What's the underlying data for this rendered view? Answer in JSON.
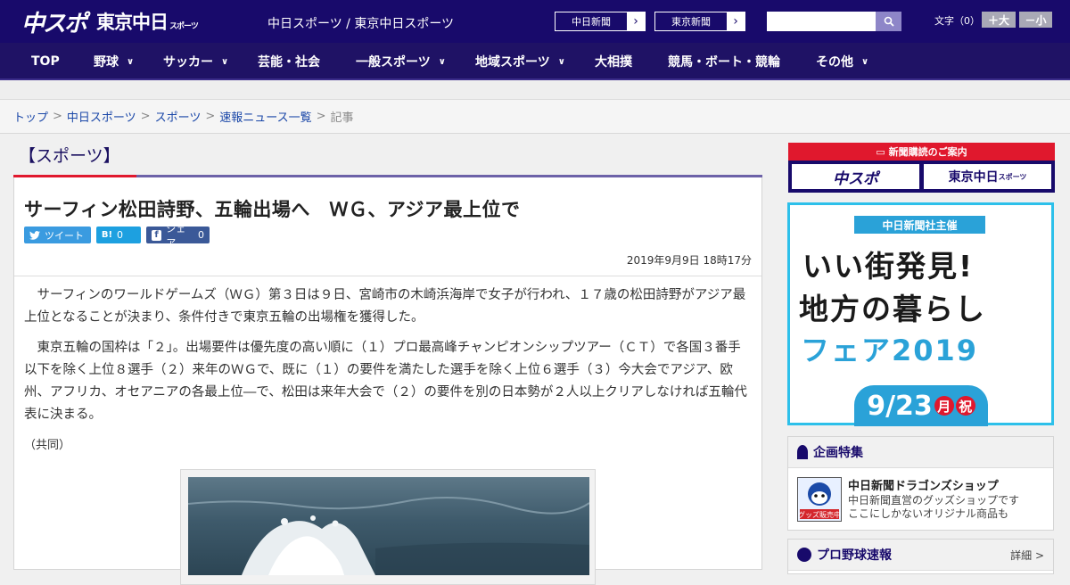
{
  "header": {
    "logo_chunichi": "中スポ",
    "logo_tokyo": "東京中日",
    "logo_tokyo_small": "スポーツ",
    "site_name": "中日スポーツ / 東京中日スポーツ",
    "paper_links": [
      {
        "label": "中日新聞"
      },
      {
        "label": "東京新聞"
      }
    ],
    "search_placeholder": "",
    "font_size_label": "文字（0）",
    "font_larger": "＋大",
    "font_smaller": "－小"
  },
  "nav": {
    "items": [
      {
        "label": "TOP",
        "has_menu": false
      },
      {
        "label": "野球",
        "has_menu": true
      },
      {
        "label": "サッカー",
        "has_menu": true
      },
      {
        "label": "芸能・社会",
        "has_menu": false
      },
      {
        "label": "一般スポーツ",
        "has_menu": true
      },
      {
        "label": "地域スポーツ",
        "has_menu": true
      },
      {
        "label": "大相撲",
        "has_menu": false
      },
      {
        "label": "競馬・ボート・競輪",
        "has_menu": false
      },
      {
        "label": "その他",
        "has_menu": true
      }
    ]
  },
  "breadcrumb": {
    "items": [
      "トップ",
      "中日スポーツ",
      "スポーツ",
      "速報ニュース一覧"
    ],
    "current": "記事",
    "separator": ">"
  },
  "article": {
    "category": "【スポーツ】",
    "headline": "サーフィン松田詩野、五輪出場へ　ＷＧ、アジア最上位で",
    "share_tweet": "ツイート",
    "share_hatena_label": "B!",
    "share_hatena_count": "0",
    "share_fb": "シェア",
    "share_fb_count": "0",
    "date": "2019年9月9日 18時17分",
    "paragraphs": [
      "サーフィンのワールドゲームズ（ＷＧ）第３日は９日、宮崎市の木崎浜海岸で女子が行われ、１７歳の松田詩野がアジア最上位となることが決まり、条件付きで東京五輪の出場権を獲得した。",
      "東京五輪の国枠は「２」。出場要件は優先度の高い順に（１）プロ最高峰チャンピオンシップツアー（ＣＴ）で各国３番手以下を除く上位８選手（２）来年のＷＧで、既に（１）の要件を満たした選手を除く上位６選手（３）今大会でアジア、欧州、アフリカ、オセアニアの各最上位―で、松田は来年大会で（２）の要件を別の日本勢が２人以上クリアしなければ五輪代表に決まる。"
    ],
    "credit": "（共同）"
  },
  "sidebar": {
    "subscribe_title": "新聞購読のご案内",
    "subscribe_chunichi": "中スポ",
    "subscribe_tokyo": "東京中日",
    "subscribe_tokyo_small": "スポーツ",
    "ad": {
      "organizer": "中日新聞社主催",
      "line1": "いい街発見!",
      "line2": "地方の暮らし",
      "line3": "フェア2019",
      "date": "9/23",
      "day": "月",
      "holiday": "祝"
    },
    "feature_title": "企画特集",
    "shop_title": "中日新聞ドラゴンズショップ",
    "shop_desc1": "中日新聞直営のグッズショップです",
    "shop_desc2": "ここにしかないオリジナル商品も",
    "shop_badge": "グッズ販売中",
    "baseball_title": "プロ野球速報",
    "baseball_more": "詳細 >"
  },
  "colors": {
    "brand_navy": "#180a6b",
    "accent_red": "#e0182d",
    "ad_blue": "#2aa2d8"
  }
}
